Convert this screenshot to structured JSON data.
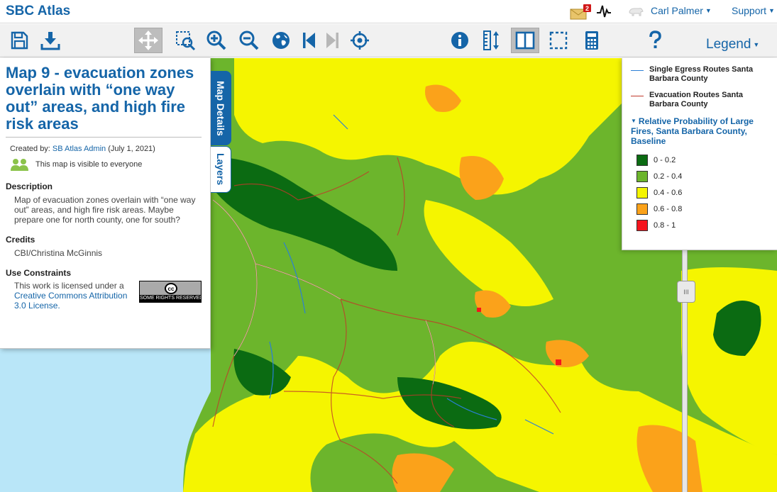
{
  "app": {
    "title": "SBC Atlas"
  },
  "header": {
    "notifications_count": "2",
    "user_name": "Carl Palmer",
    "support_label": "Support"
  },
  "toolbar": {
    "legend_label": "Legend",
    "icons": [
      "save-icon",
      "download-icon",
      "pan-icon",
      "zoom-box-icon",
      "zoom-in-icon",
      "zoom-out-icon",
      "globe-icon",
      "previous-extent-icon",
      "next-extent-icon",
      "locate-icon",
      "info-icon",
      "measure-icon",
      "split-view-icon",
      "select-area-icon",
      "calculator-icon",
      "help-icon"
    ]
  },
  "details": {
    "title": "Map 9 - evacuation zones overlain with “one way out” areas, and high fire risk areas",
    "created_prefix": "Created by: ",
    "author": "SB Atlas Admin",
    "date": " (July 1, 2021)",
    "visibility": "This map is visible to everyone",
    "description_heading": "Description",
    "description": "Map of evacuation zones overlain with “one way out” areas, and high fire risk areas. Maybe prepare one for north county, one for south?",
    "credits_heading": "Credits",
    "credits": "CBI/Christina McGinnis",
    "constraints_heading": "Use Constraints",
    "license_prefix": "This work is licensed under a ",
    "license_link": "Creative Commons Attribution 3.0 License.",
    "badge_mark": "cc",
    "badge_text": "SOME RIGHTS RESERVED"
  },
  "tabs": {
    "details": "Map Details",
    "layers": "Layers"
  },
  "legend": {
    "lines": [
      {
        "label": "Single Egress Routes Santa Barbara County",
        "color": "#2b7fd6"
      },
      {
        "label": "Evacuation Routes Santa Barbara County",
        "color": "#c0392b"
      }
    ],
    "group_title": "Relative Probability of Large Fires, Santa Barbara County, Baseline",
    "classes": [
      {
        "label": "0 - 0.2",
        "color": "#0b6b12"
      },
      {
        "label": "0.2 - 0.4",
        "color": "#6cb52c"
      },
      {
        "label": "0.4 - 0.6",
        "color": "#f5f500"
      },
      {
        "label": "0.6 - 0.8",
        "color": "#fba21a"
      },
      {
        "label": "0.8 - 1",
        "color": "#f5141e"
      }
    ]
  },
  "map": {
    "slider_grip": "III"
  }
}
